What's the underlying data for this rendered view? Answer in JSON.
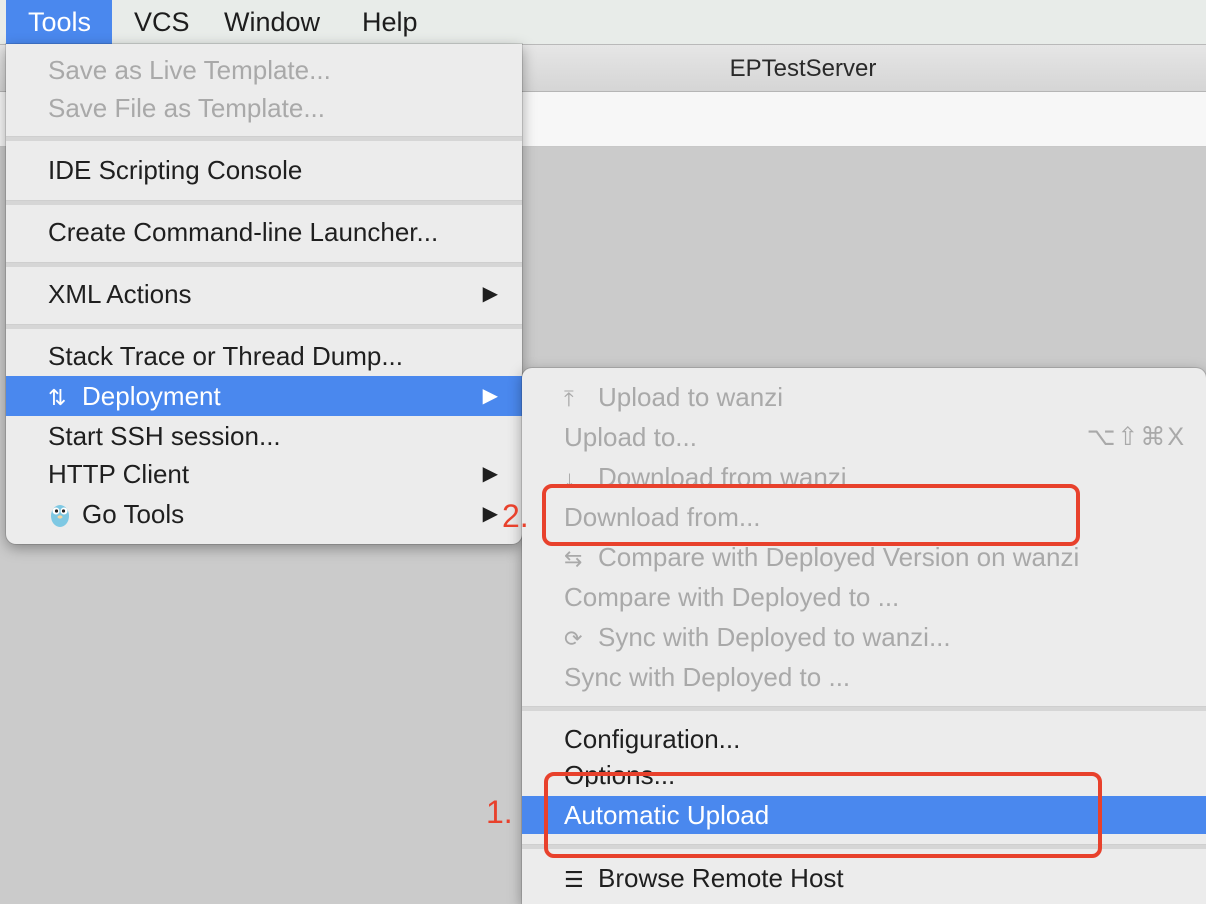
{
  "menubar": {
    "items": [
      "Tools",
      "VCS",
      "Window",
      "Help"
    ]
  },
  "window": {
    "title": "EPTestServer"
  },
  "tools_menu": {
    "items": [
      {
        "label": "Save as Live Template...",
        "disabled": true
      },
      {
        "label": "Save File as Template...",
        "disabled": true
      },
      {
        "label": "IDE Scripting Console"
      },
      {
        "label": "Create Command-line Launcher..."
      },
      {
        "label": "XML Actions",
        "submenu": true
      },
      {
        "label": "Stack Trace or Thread Dump..."
      },
      {
        "label": "Deployment",
        "submenu": true,
        "selected": true,
        "icon": "updown-arrows-icon"
      },
      {
        "label": "Start SSH session..."
      },
      {
        "label": "HTTP Client",
        "submenu": true
      },
      {
        "label": "Go Tools",
        "submenu": true,
        "icon": "gopher-icon"
      }
    ],
    "arrow": "▶"
  },
  "deployment_menu": {
    "items": [
      {
        "label": "Upload to wanzi",
        "disabled": true,
        "icon": "upload-icon"
      },
      {
        "label": "Upload to...",
        "disabled": true,
        "shortcut": "⌥⇧⌘X"
      },
      {
        "label": "Download from wanzi",
        "disabled": true,
        "icon": "download-icon"
      },
      {
        "label": "Download from...",
        "disabled": true
      },
      {
        "label": "Compare with Deployed Version on wanzi",
        "disabled": true,
        "icon": "compare-icon"
      },
      {
        "label": "Compare with Deployed to ...",
        "disabled": true
      },
      {
        "label": "Sync with Deployed to wanzi...",
        "disabled": true,
        "icon": "sync-icon"
      },
      {
        "label": "Sync with Deployed to ...",
        "disabled": true
      },
      {
        "label": "Configuration..."
      },
      {
        "label": "Options..."
      },
      {
        "label": "Automatic Upload",
        "selected": true
      },
      {
        "label": "Browse Remote Host",
        "icon": "server-icon"
      }
    ]
  },
  "annotations": {
    "one": "1.",
    "two": "2.",
    "color": "#e8412c"
  },
  "colors": {
    "selection": "#4a88ee",
    "menu_bg": "#ececec",
    "disabled_text": "#a9a9a9"
  }
}
